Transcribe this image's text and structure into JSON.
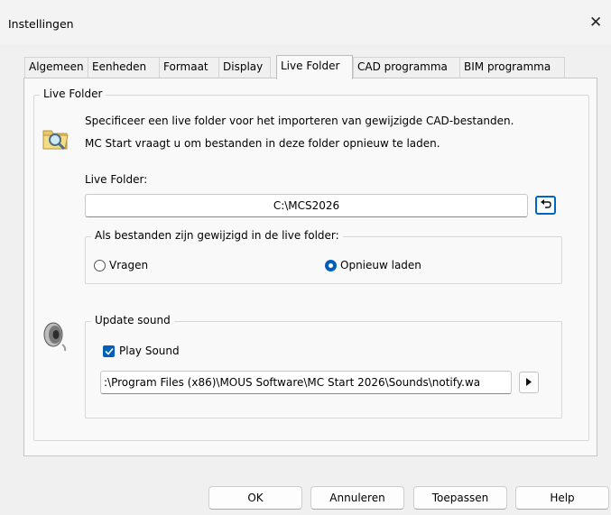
{
  "window": {
    "title": "Instellingen",
    "close_glyph": "✕"
  },
  "tabs": [
    {
      "label": "Algemeen"
    },
    {
      "label": "Eenheden"
    },
    {
      "label": "Formaat"
    },
    {
      "label": "Display"
    },
    {
      "label": "Live Folder",
      "active": true
    },
    {
      "label": "CAD programma"
    },
    {
      "label": "BIM programma"
    }
  ],
  "live_folder": {
    "group_title": "Live Folder",
    "description_line1": "Specificeer een live folder voor het importeren van gewijzigde CAD-bestanden.",
    "description_line2": "MC Start vraagt u om bestanden in deze folder opnieuw te laden.",
    "folder_label": "Live Folder:",
    "folder_value": "C:\\MCS2026",
    "reset_icon": "undo-icon",
    "changed_group_title": "Als bestanden zijn gewijzigd in de live folder:",
    "option_ask": "Vragen",
    "option_reload": "Opnieuw laden",
    "selected": "Opnieuw laden"
  },
  "update_sound": {
    "group_title": "Update sound",
    "play_sound_label": "Play Sound",
    "play_sound_checked": true,
    "sound_path": ":\\Program Files (x86)\\MOUS Software\\MC Start 2026\\Sounds\\notify.wa",
    "play_icon": "play-icon"
  },
  "buttons": {
    "ok": "OK",
    "cancel": "Annuleren",
    "apply": "Toepassen",
    "help": "Help"
  },
  "colors": {
    "accent": "#005fb8",
    "focus": "#0067c0"
  }
}
